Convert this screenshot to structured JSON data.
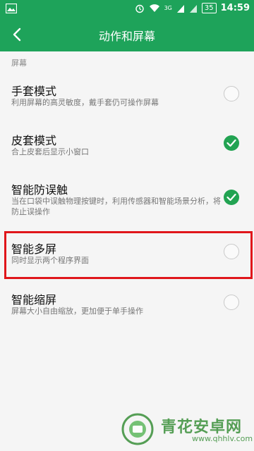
{
  "status_bar": {
    "network": "3G",
    "battery": "35",
    "time": "14:59"
  },
  "header": {
    "title": "动作和屏幕"
  },
  "section": {
    "label": "屏幕"
  },
  "settings": [
    {
      "title": "手套模式",
      "subtitle": "利用屏幕的高灵敏度，戴手套仍可操作屏幕",
      "checked": false
    },
    {
      "title": "皮套模式",
      "subtitle": "合上皮套后显示小窗口",
      "checked": true
    },
    {
      "title": "智能防误触",
      "subtitle": "当在口袋中误触物理按键时，利用传感器和智能场景分析，将防止误操作",
      "checked": true
    },
    {
      "title": "智能多屏",
      "subtitle": "同时显示两个程序界面",
      "checked": false
    },
    {
      "title": "智能缩屏",
      "subtitle": "屏幕大小自由缩放，更加便于单手操作",
      "checked": false
    }
  ],
  "watermark": {
    "text": "青花安卓网",
    "url": "www.qhhlv.com"
  },
  "colors": {
    "accent": "#1ea35a",
    "highlight": "#e0161b"
  }
}
